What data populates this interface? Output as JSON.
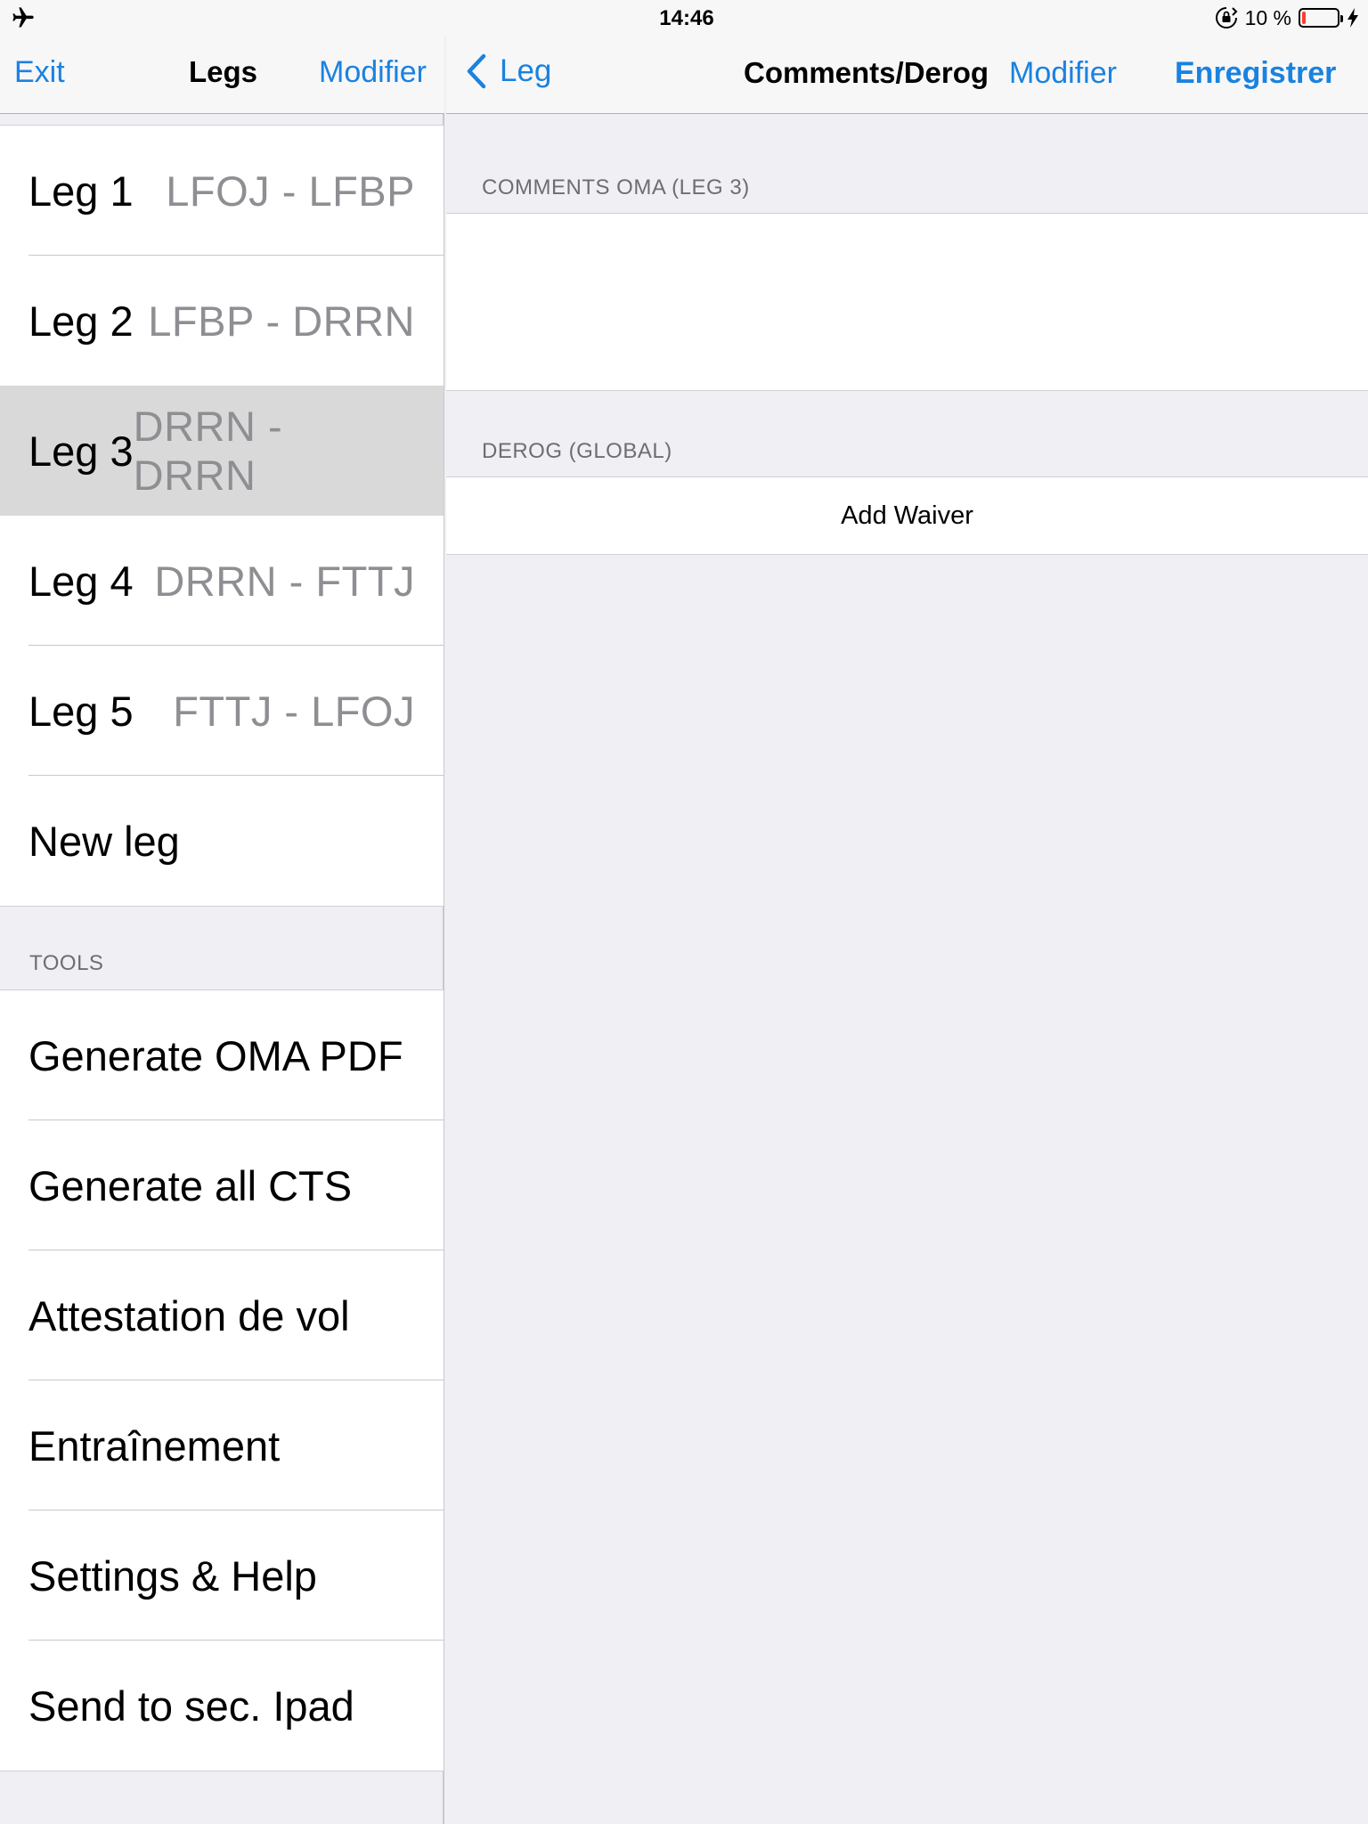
{
  "status_bar": {
    "time": "14:46",
    "battery_text": "10 %",
    "battery_level_percent": 10,
    "airplane_mode": true
  },
  "left_nav": {
    "exit_label": "Exit",
    "title": "Legs",
    "modifier_label": "Modifier"
  },
  "legs": [
    {
      "label": "Leg 1",
      "route": "LFOJ - LFBP",
      "selected": false
    },
    {
      "label": "Leg 2",
      "route": "LFBP - DRRN",
      "selected": false
    },
    {
      "label": "Leg 3",
      "route": "DRRN - DRRN",
      "selected": true
    },
    {
      "label": "Leg 4",
      "route": "DRRN - FTTJ",
      "selected": false
    },
    {
      "label": "Leg 5",
      "route": "FTTJ - LFOJ",
      "selected": false
    }
  ],
  "new_leg_label": "New leg",
  "tools": {
    "header": "TOOLS",
    "items": [
      "Generate OMA PDF",
      "Generate all CTS",
      "Attestation de vol",
      "Entraînement",
      "Settings & Help",
      "Send to sec. Ipad"
    ]
  },
  "right_nav": {
    "back_label": "Leg",
    "title": "Comments/Derog",
    "modifier_label": "Modifier",
    "save_label": "Enregistrer"
  },
  "comments": {
    "header": "COMMENTS OMA (LEG 3)",
    "value": ""
  },
  "derog": {
    "header": "DEROG (GLOBAL)",
    "add_waiver_label": "Add Waiver"
  },
  "colors": {
    "accent": "#1a82e0",
    "background": "#efeff4",
    "selected_row": "#d9d9d9",
    "secondary_text": "#8e8e93",
    "battery_low": "#ff3b30"
  }
}
